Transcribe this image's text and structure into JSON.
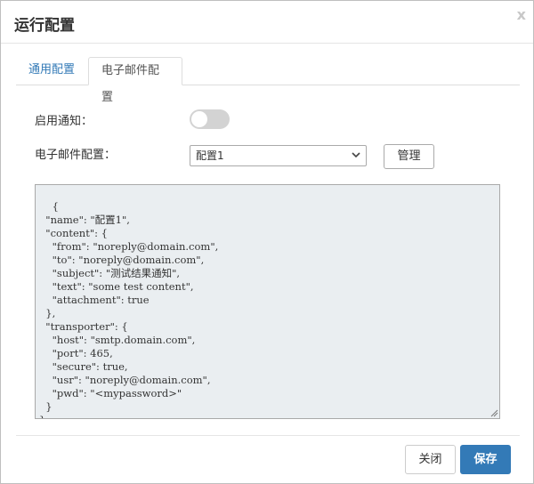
{
  "dialog": {
    "title": "运行配置",
    "close_glyph": "x"
  },
  "tabs": [
    {
      "label": "通用配置",
      "active": false
    },
    {
      "label": "电子邮件配置",
      "active": true
    }
  ],
  "form": {
    "enable_notification_label": "启用通知：",
    "enable_notification_on": false,
    "email_config_label": "电子邮件配置：",
    "email_config_selected": "配置1",
    "manage_label": "管理",
    "config_json": "{\n  \"name\": \"配置1\",\n  \"content\": {\n    \"from\": \"noreply@domain.com\",\n    \"to\": \"noreply@domain.com\",\n    \"subject\": \"测试结果通知\",\n    \"text\": \"some test content\",\n    \"attachment\": true\n  },\n  \"transporter\": {\n    \"host\": \"smtp.domain.com\",\n    \"port\": 465,\n    \"secure\": true,\n    \"usr\": \"noreply@domain.com\",\n    \"pwd\": \"<mypassword>\"\n  }\n}"
  },
  "footer": {
    "close_label": "关闭",
    "save_label": "保存"
  },
  "colors": {
    "accent": "#337ab7",
    "code_bg": "#eaeef1",
    "toggle_off": "#d3d3d3"
  }
}
